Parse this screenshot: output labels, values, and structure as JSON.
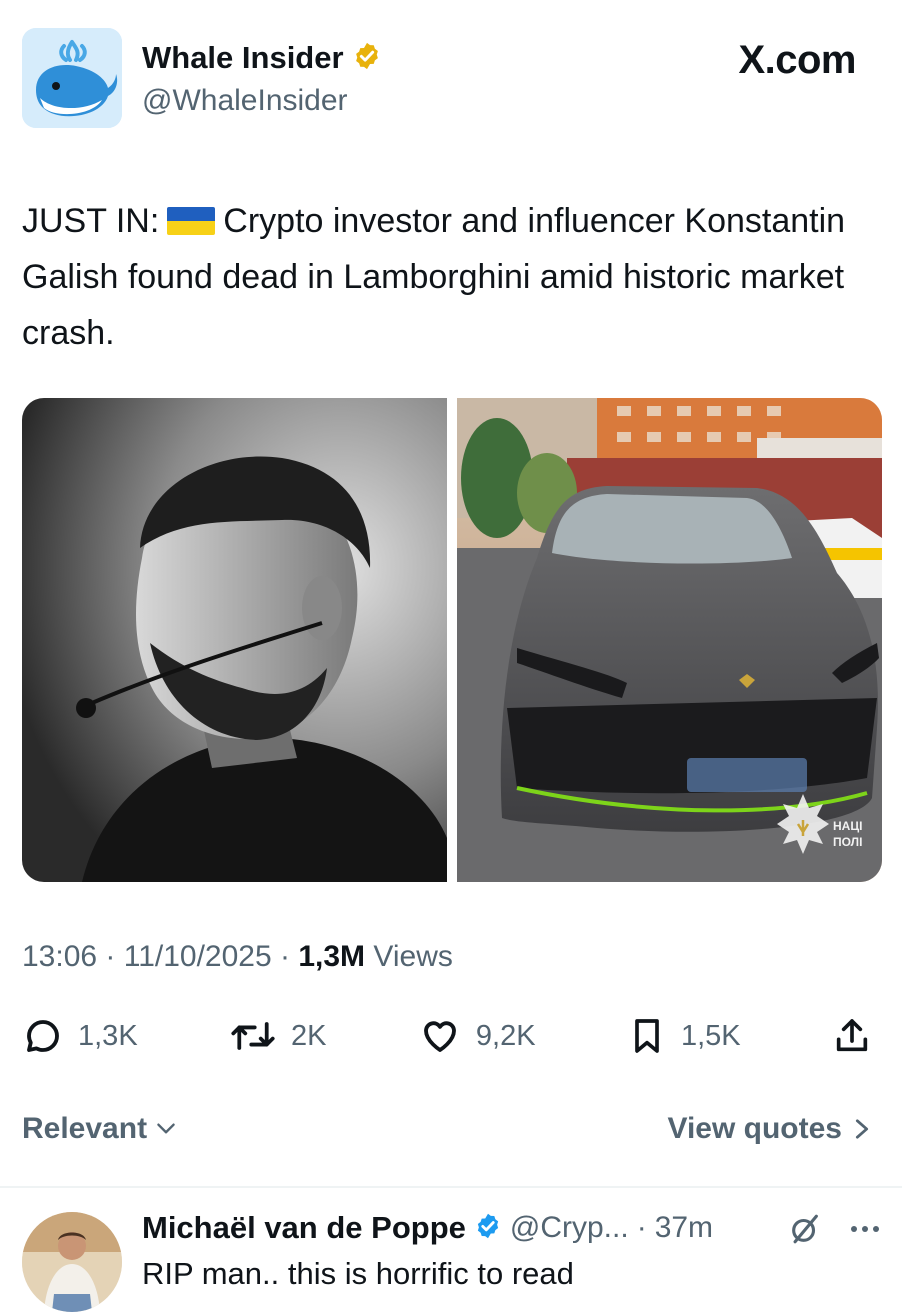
{
  "header": {
    "name": "Whale Insider",
    "handle": "@WhaleInsider",
    "brand": "X.com",
    "verified_color": "#e8b20c"
  },
  "tweet": {
    "text_prefix": "JUST IN:",
    "flag_icon": "ukraine-flag-icon",
    "text_body": "Crypto investor and influencer Konstantin Galish found dead in Lamborghini amid historic market crash.",
    "images": [
      "person-portrait",
      "lamborghini-car"
    ],
    "watermark": "НАЦІ\nПОЛІ"
  },
  "meta": {
    "time": "13:06",
    "date": "11/10/2025",
    "views_count": "1,3M",
    "views_label": "Views"
  },
  "actions": {
    "replies": "1,3K",
    "reposts": "2K",
    "likes": "9,2K",
    "bookmarks": "1,5K"
  },
  "sort": {
    "label": "Relevant",
    "view_quotes": "View quotes"
  },
  "reply": {
    "name": "Michaël van de Poppe",
    "handle": "@Cryp...",
    "time": "37m",
    "text": "RIP man.. this is horrific to read",
    "verified_color": "#1d9bf0"
  },
  "colors": {
    "text_primary": "#0f1419",
    "text_secondary": "#536471",
    "flag_blue": "#1f5fbf",
    "flag_yellow": "#f7d117"
  }
}
